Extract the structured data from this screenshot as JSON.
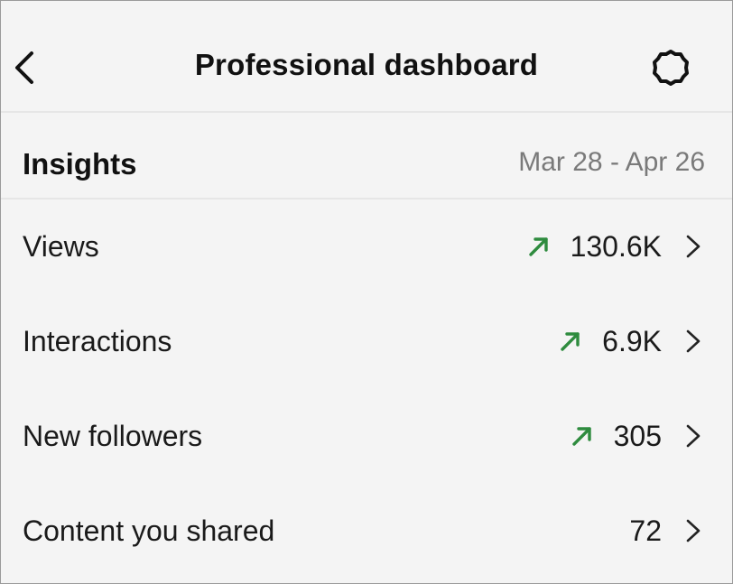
{
  "header": {
    "title": "Professional dashboard",
    "back_icon": "chevron-left-icon",
    "settings_icon": "gear-icon"
  },
  "insights": {
    "title": "Insights",
    "date_range": "Mar 28 - Apr 26"
  },
  "metrics": [
    {
      "label": "Views",
      "value": "130.6K",
      "trend": "up"
    },
    {
      "label": "Interactions",
      "value": "6.9K",
      "trend": "up"
    },
    {
      "label": "New followers",
      "value": "305",
      "trend": "up"
    },
    {
      "label": "Content you shared",
      "value": "72",
      "trend": "none"
    }
  ],
  "colors": {
    "trend_up": "#2e8b3e",
    "date_text": "#7a7a7a",
    "background": "#f4f4f4"
  }
}
